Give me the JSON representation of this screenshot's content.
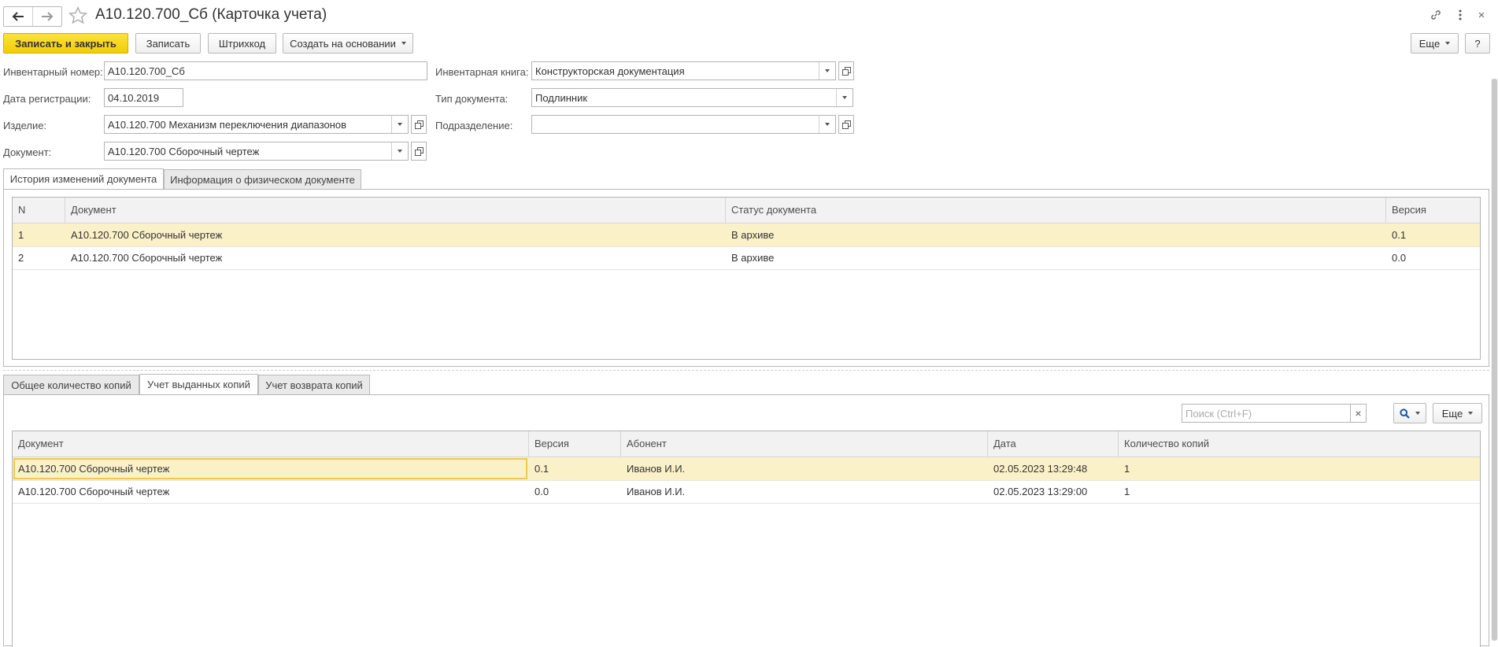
{
  "window": {
    "title": "А10.120.700_Сб (Карточка учета)",
    "close_glyph": "×"
  },
  "toolbar": {
    "save_close_label": "Записать и закрыть",
    "save_label": "Записать",
    "barcode_label": "Штрихкод",
    "create_based_label": "Создать на основании",
    "more_label": "Еще",
    "help_label": "?"
  },
  "form": {
    "inv_number": {
      "label": "Инвентарный номер:",
      "value": "А10.120.700_Сб"
    },
    "reg_date": {
      "label": "Дата регистрации:",
      "value": "04.10.2019"
    },
    "product": {
      "label": "Изделие:",
      "value": "А10.120.700 Механизм переключения диапазонов"
    },
    "document": {
      "label": "Документ:",
      "value": "А10.120.700 Сборочный чертеж"
    },
    "inv_book": {
      "label": "Инвентарная книга:",
      "value": "Конструкторская документация"
    },
    "doc_type": {
      "label": "Тип документа:",
      "value": "Подлинник"
    },
    "department": {
      "label": "Подразделение:",
      "value": ""
    }
  },
  "top_tabs": [
    {
      "label": "История изменений документа",
      "active": true
    },
    {
      "label": "Информация о физическом документе",
      "active": false
    }
  ],
  "history_table": {
    "columns": [
      "N",
      "Документ",
      "Статус документа",
      "Версия"
    ],
    "rows": [
      {
        "n": "1",
        "document": "А10.120.700 Сборочный чертеж",
        "status": "В архиве",
        "version": "0.1"
      },
      {
        "n": "2",
        "document": "А10.120.700 Сборочный чертеж",
        "status": "В архиве",
        "version": "0.0"
      }
    ]
  },
  "bottom_tabs": [
    {
      "label": "Общее количество копий",
      "active": false
    },
    {
      "label": "Учет выданных копий",
      "active": true
    },
    {
      "label": "Учет возврата копий",
      "active": false
    }
  ],
  "copies": {
    "search_placeholder": "Поиск (Ctrl+F)",
    "clear_glyph": "×",
    "more_label": "Еще",
    "columns": [
      "Документ",
      "Версия",
      "Абонент",
      "Дата",
      "Количество копий"
    ],
    "rows": [
      {
        "document": "А10.120.700 Сборочный чертеж",
        "version": "0.1",
        "subscriber": "Иванов И.И.",
        "date": "02.05.2023 13:29:48",
        "count": "1"
      },
      {
        "document": "А10.120.700 Сборочный чертеж",
        "version": "0.0",
        "subscriber": "Иванов И.И.",
        "date": "02.05.2023 13:29:00",
        "count": "1"
      }
    ]
  },
  "colors": {
    "primary_button": "#f2cd05",
    "selected_row": "#fbf1c8",
    "focus_border": "#f2c94c"
  }
}
